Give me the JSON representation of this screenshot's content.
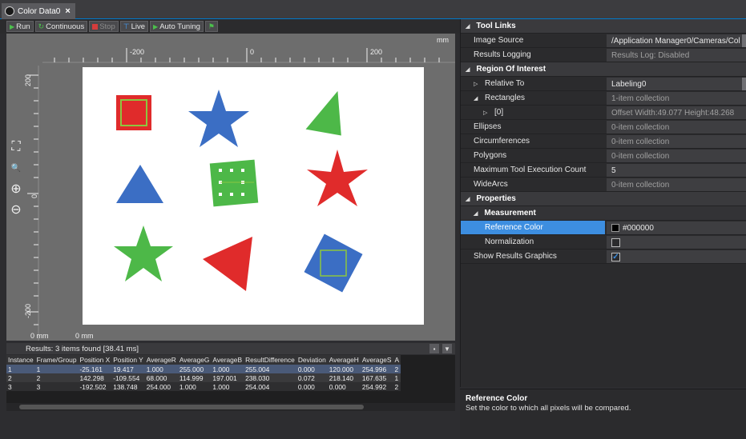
{
  "tab": {
    "title": "Color Data0",
    "close": "×"
  },
  "toolbar": {
    "run": "Run",
    "continuous": "Continuous",
    "stop": "Stop",
    "live": "Live",
    "auto_tuning": "Auto Tuning"
  },
  "viewer": {
    "unit_top": "mm",
    "ruler_top_labels": [
      "-200",
      "0",
      "200"
    ],
    "ruler_left_labels": [
      "200",
      "0",
      "-200"
    ],
    "origin_x_label": "0 mm",
    "origin_y_label": "0 mm",
    "shapes": [
      {
        "kind": "square",
        "color": "#e02b2b",
        "outline": "#8cc63f"
      },
      {
        "kind": "star",
        "color": "#3b6ec4"
      },
      {
        "kind": "triangle",
        "color": "#4db848"
      },
      {
        "kind": "triangle",
        "color": "#3b6ec4"
      },
      {
        "kind": "square",
        "color": "#4db848"
      },
      {
        "kind": "star",
        "color": "#e02b2b"
      },
      {
        "kind": "star",
        "color": "#4db848"
      },
      {
        "kind": "triangle",
        "color": "#e02b2b"
      },
      {
        "kind": "square",
        "color": "#3b6ec4",
        "outline": "#8cc63f"
      }
    ]
  },
  "results": {
    "summary": "Results: 3 items found [38.41 ms]",
    "columns": [
      "Instance",
      "Frame/Group",
      "Position X",
      "Position Y",
      "AverageR",
      "AverageG",
      "AverageB",
      "ResultDifference",
      "Deviation",
      "AverageH",
      "AverageS",
      "A"
    ],
    "rows": [
      [
        "1",
        "1",
        "-25.161",
        "19.417",
        "1.000",
        "255.000",
        "1.000",
        "255.004",
        "0.000",
        "120.000",
        "254.996",
        "2"
      ],
      [
        "2",
        "2",
        "142.298",
        "-109.554",
        "68.000",
        "114.999",
        "197.001",
        "238.030",
        "0.072",
        "218.140",
        "167.635",
        "1"
      ],
      [
        "3",
        "3",
        "-192.502",
        "138.748",
        "254.000",
        "1.000",
        "1.000",
        "254.004",
        "0.000",
        "0.000",
        "254.992",
        "2"
      ]
    ]
  },
  "properties": {
    "tool_links": "Tool Links",
    "image_source_label": "Image Source",
    "image_source_value": "/Application Manager0/Cameras/Col",
    "results_logging_label": "Results Logging",
    "results_logging_value": "Results Log: Disabled",
    "roi": "Region Of Interest",
    "relative_to_label": "Relative To",
    "relative_to_value": "Labeling0",
    "rectangles_label": "Rectangles",
    "rectangles_value": "1-item collection",
    "rect0_label": "[0]",
    "rect0_value": "Offset Width:49.077 Height:48.268",
    "ellipses_label": "Ellipses",
    "ellipses_value": "0-item collection",
    "circumferences_label": "Circumferences",
    "circumferences_value": "0-item collection",
    "polygons_label": "Polygons",
    "polygons_value": "0-item collection",
    "max_exec_label": "Maximum Tool Execution Count",
    "max_exec_value": "5",
    "widearcs_label": "WideArcs",
    "widearcs_value": "0-item collection",
    "properties": "Properties",
    "measurement": "Measurement",
    "ref_color_label": "Reference Color",
    "ref_color_value": "#000000",
    "normalization_label": "Normalization",
    "normalization_checked": false,
    "show_results_label": "Show Results Graphics",
    "show_results_checked": true
  },
  "description": {
    "title": "Reference Color",
    "text": "Set the color to which all pixels will be compared."
  }
}
